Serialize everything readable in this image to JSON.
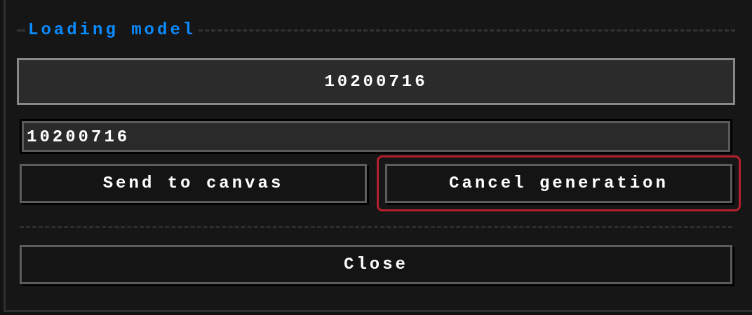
{
  "section": {
    "title": "Loading model"
  },
  "seed_display": {
    "text": "10200716"
  },
  "seed_input": {
    "value": "10200716"
  },
  "actions": [
    {
      "label": "Send to canvas",
      "focused": false
    },
    {
      "label": "Cancel generation",
      "focused": true
    }
  ],
  "close_button": {
    "label": "Close",
    "focused": false
  }
}
